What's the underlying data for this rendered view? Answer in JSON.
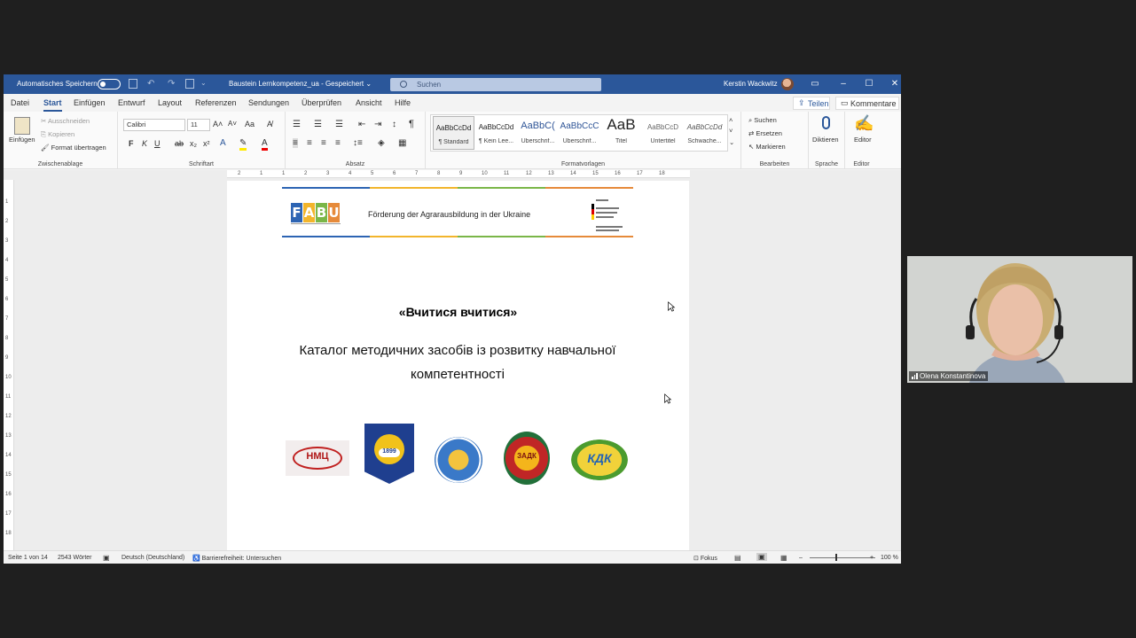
{
  "titlebar": {
    "autosave_label": "Automatisches Speichern",
    "doc_title": "Baustein Lernkompetenz_ua - Gespeichert",
    "doc_title_chevron": "⌄",
    "search_placeholder": "Suchen",
    "user_name": "Kerstin Wackwitz"
  },
  "menu": {
    "items": [
      "Datei",
      "Start",
      "Einfügen",
      "Entwurf",
      "Layout",
      "Referenzen",
      "Sendungen",
      "Überprüfen",
      "Ansicht",
      "Hilfe"
    ],
    "active": "Start",
    "share": "Teilen",
    "comments": "Kommentare"
  },
  "ribbon": {
    "clipboard": {
      "paste": "Einfügen",
      "cut": "Ausschneiden",
      "copy": "Kopieren",
      "format_painter": "Format übertragen",
      "label": "Zwischenablage"
    },
    "font": {
      "name": "Calibri",
      "size": "11",
      "label": "Schriftart",
      "bold": "F",
      "italic": "K",
      "underline": "U"
    },
    "paragraph": {
      "label": "Absatz",
      "pilcrow": "¶"
    },
    "styles": {
      "label": "Formatvorlagen",
      "items": [
        {
          "preview": "AaBbCcDd",
          "name": "¶ Standard"
        },
        {
          "preview": "AaBbCcDd",
          "name": "¶ Kein Lee..."
        },
        {
          "preview": "AaBbC(",
          "name": "Überschrif..."
        },
        {
          "preview": "AaBbCcC",
          "name": "Überschrif..."
        },
        {
          "preview": "AaB",
          "name": "Titel"
        },
        {
          "preview": "AaBbCcD",
          "name": "Untertitel"
        },
        {
          "preview": "AaBbCcDd",
          "name": "Schwache..."
        }
      ]
    },
    "editing": {
      "find": "Suchen",
      "replace": "Ersetzen",
      "select": "Markieren",
      "label": "Bearbeiten"
    },
    "voice": {
      "dictate": "Diktieren",
      "label": "Sprache"
    },
    "editor": {
      "editor": "Editor",
      "label": "Editor"
    }
  },
  "ruler": {
    "h_ticks": [
      "2",
      "1",
      "1",
      "2",
      "3",
      "4",
      "5",
      "6",
      "7",
      "8",
      "9",
      "10",
      "11",
      "12",
      "13",
      "14",
      "15",
      "16",
      "17",
      "18"
    ],
    "v_ticks": [
      "1",
      "2",
      "3",
      "4",
      "5",
      "6",
      "7",
      "8",
      "9",
      "10",
      "11",
      "12",
      "13",
      "14",
      "15",
      "16",
      "17",
      "18"
    ]
  },
  "document": {
    "header_text": "Förderung der Agrarausbildung in der Ukraine",
    "fabu_letters": [
      "F",
      "A",
      "B",
      "U"
    ],
    "title": "«Вчитися вчитися»",
    "subtitle": "Каталог методичних засобів із розвитку навчальної компетентності",
    "logos": [
      "НМЦ",
      "1899",
      "",
      "ЗАДК",
      "КДК"
    ]
  },
  "status": {
    "page": "Seite 1 von 14",
    "words": "2543 Wörter",
    "language": "Deutsch (Deutschland)",
    "accessibility": "Barrierefreiheit: Untersuchen",
    "focus": "Fokus",
    "zoom": "100 %"
  },
  "video": {
    "participant": "Olena Konstantinova"
  }
}
